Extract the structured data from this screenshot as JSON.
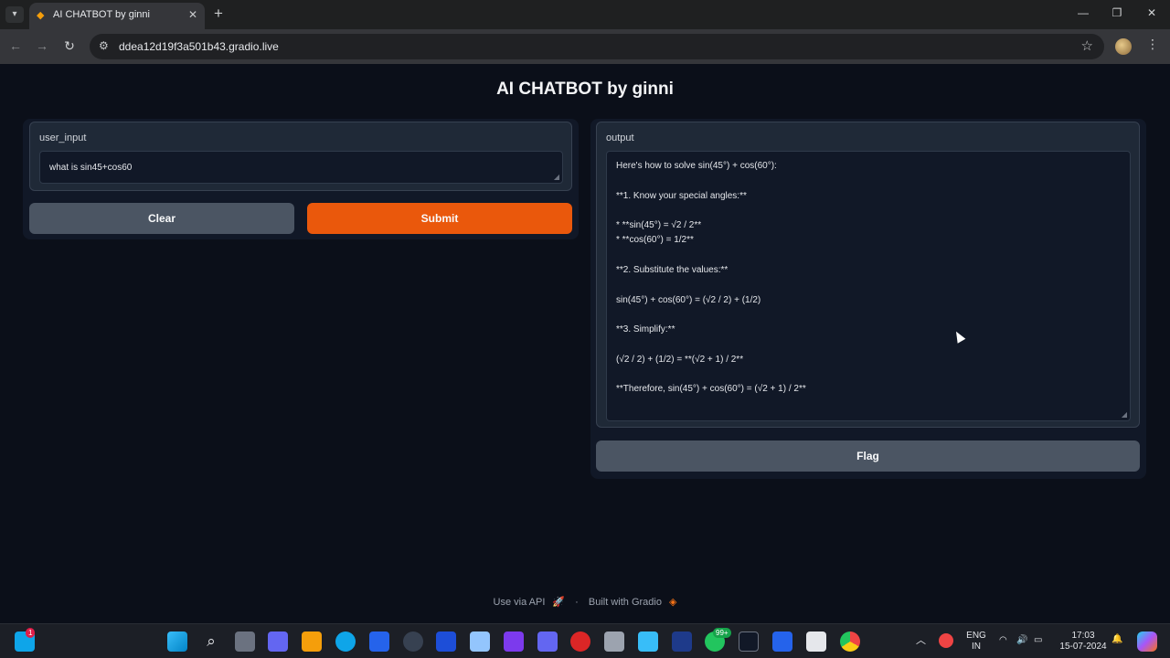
{
  "browser": {
    "tab_title": "AI CHATBOT by ginni",
    "url": "ddea12d19f3a501b43.gradio.live",
    "new_tab": "+",
    "close": "✕"
  },
  "app": {
    "title": "AI CHATBOT by ginni",
    "input_label": "user_input",
    "input_value": "what is sin45+cos60",
    "clear_label": "Clear",
    "submit_label": "Submit",
    "output_label": "output",
    "output_value": "Here's how to solve sin(45°) + cos(60°):\n\n**1. Know your special angles:**\n\n* **sin(45°) = √2 / 2**\n* **cos(60°) = 1/2**\n\n**2. Substitute the values:**\n\nsin(45°) + cos(60°) = (√2 / 2) + (1/2)\n\n**3. Simplify:**\n\n(√2 / 2) + (1/2) = **(√2 + 1) / 2**\n\n**Therefore, sin(45°) + cos(60°) = (√2 + 1) / 2**",
    "flag_label": "Flag"
  },
  "footer": {
    "api": "Use via API",
    "separator": "·",
    "built": "Built with Gradio"
  },
  "taskbar": {
    "lang_line1": "ENG",
    "lang_line2": "IN",
    "time": "17:03",
    "date": "15-07-2024",
    "whatsapp_badge": "99+",
    "widget_badge": "1"
  },
  "colors": {
    "accent": "#ea580c",
    "background": "#0b0f19",
    "panel": "#1f2937"
  }
}
